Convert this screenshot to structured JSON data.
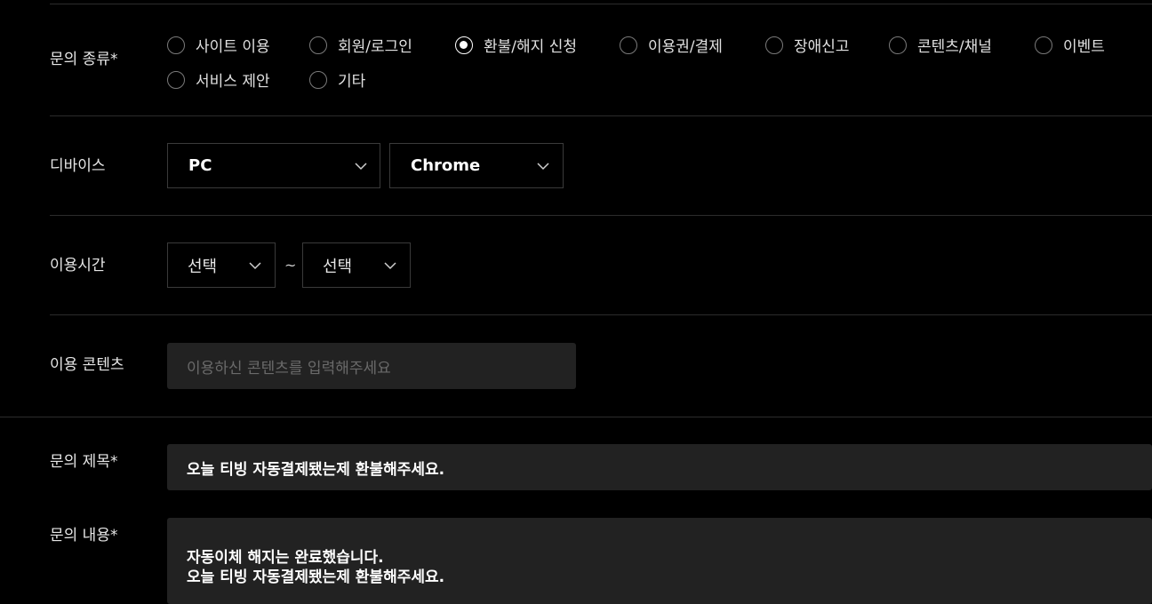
{
  "inquiry_type": {
    "label": "문의 종류*",
    "options": [
      {
        "label": "사이트 이용",
        "selected": false
      },
      {
        "label": "회원/로그인",
        "selected": false
      },
      {
        "label": "환불/해지 신청",
        "selected": true
      },
      {
        "label": "이용권/결제",
        "selected": false
      },
      {
        "label": "장애신고",
        "selected": false
      },
      {
        "label": "콘텐츠/채널",
        "selected": false
      },
      {
        "label": "이벤트",
        "selected": false
      },
      {
        "label": "서비스 제안",
        "selected": false
      },
      {
        "label": "기타",
        "selected": false
      }
    ]
  },
  "device": {
    "label": "디바이스",
    "platform_value": "PC",
    "browser_value": "Chrome"
  },
  "usage_time": {
    "label": "이용시간",
    "start_value": "선택",
    "separator": "~",
    "end_value": "선택"
  },
  "content": {
    "label": "이용 콘텐츠",
    "placeholder": "이용하신 콘텐츠를 입력해주세요"
  },
  "subject": {
    "label": "문의 제목*",
    "value": "오늘 티빙 자동결제됐는제 환불해주세요."
  },
  "body": {
    "label": "문의 내용*",
    "line1": "자동이체 해지는 완료했습니다.",
    "line2": "오늘 티빙 자동결제됐는제 환불해주세요."
  },
  "colors": {
    "background": "#000000",
    "field": "#222222",
    "border": "#3a3a3a",
    "divider": "#2c2c2c"
  }
}
